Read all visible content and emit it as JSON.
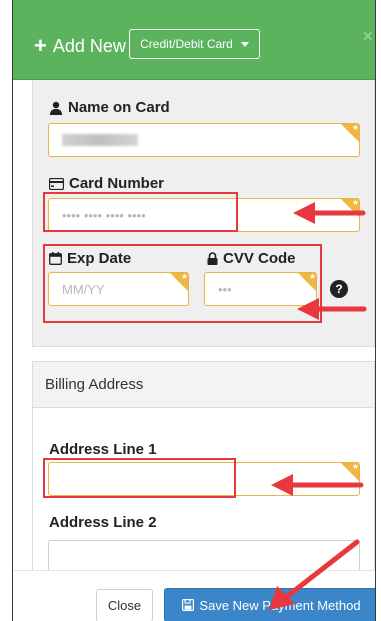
{
  "header": {
    "add_new_label": "Add New",
    "type_select_value": "Credit/Debit Card",
    "close_glyph": "×"
  },
  "card": {
    "name_label": "Name on Card",
    "number_label": "Card Number",
    "number_placeholder": "•••• •••• •••• ••••",
    "exp_label": "Exp Date",
    "exp_placeholder": "MM/YY",
    "cvv_label": "CVV Code",
    "cvv_placeholder": "•••",
    "help_glyph": "?"
  },
  "billing": {
    "heading": "Billing Address",
    "line1_label": "Address Line 1",
    "line2_label": "Address Line 2"
  },
  "footer": {
    "close_label": "Close",
    "save_label": "Save New Payment Method"
  },
  "colors": {
    "header_green": "#5bb35e",
    "required_orange": "#efb73f",
    "annotation_red": "#e8383d",
    "save_blue": "#3a86c8"
  }
}
